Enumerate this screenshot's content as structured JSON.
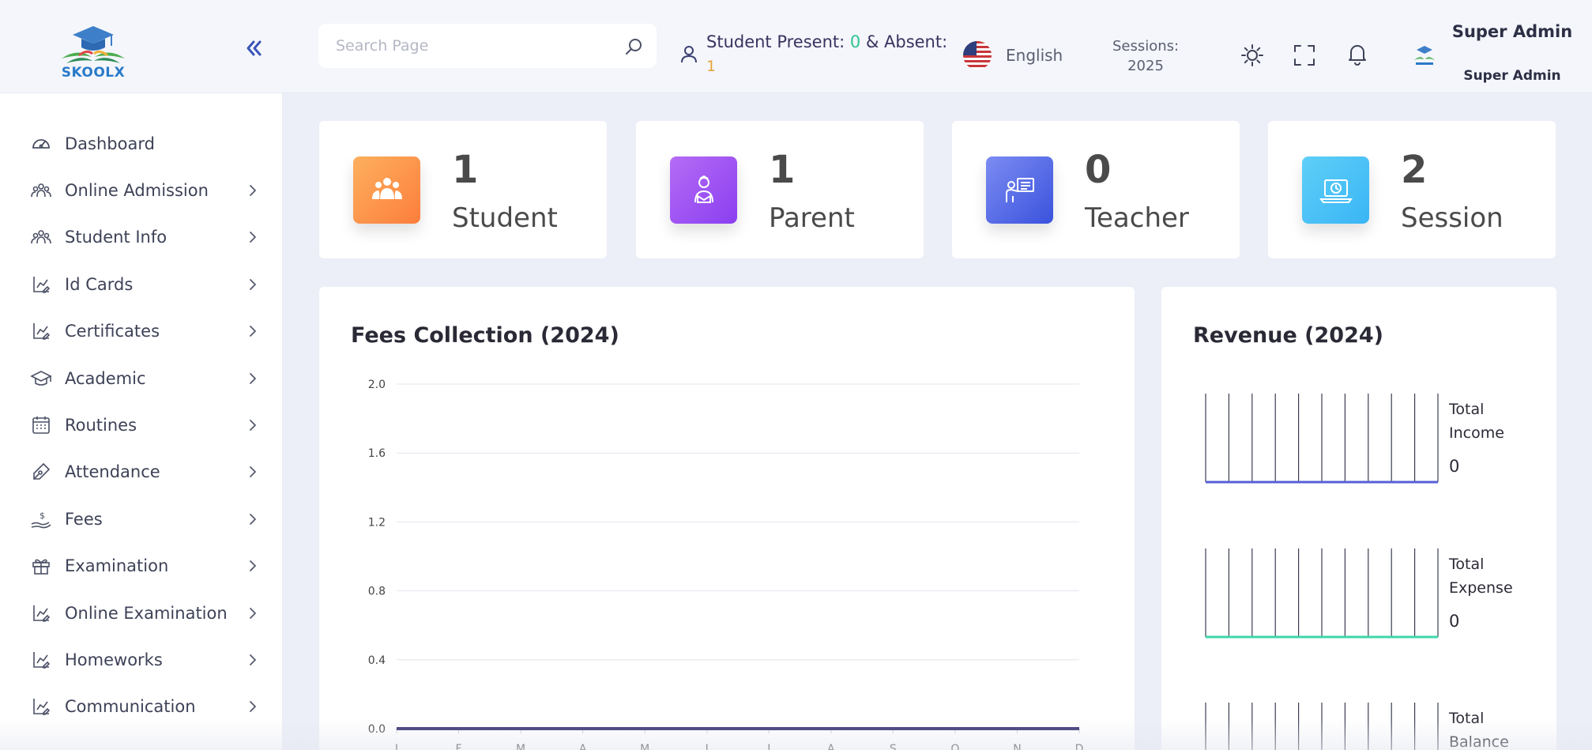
{
  "brand": {
    "name": "SKOOLX"
  },
  "sidebar": {
    "items": [
      {
        "label": "Dashboard",
        "icon": "dashboard-gauge-icon",
        "has_children": false
      },
      {
        "label": "Online Admission",
        "icon": "users-group-icon",
        "has_children": true
      },
      {
        "label": "Student Info",
        "icon": "users-group-icon",
        "has_children": true
      },
      {
        "label": "Id Cards",
        "icon": "chart-edit-icon",
        "has_children": true
      },
      {
        "label": "Certificates",
        "icon": "chart-edit-icon",
        "has_children": true
      },
      {
        "label": "Academic",
        "icon": "graduation-cap-icon",
        "has_children": true
      },
      {
        "label": "Routines",
        "icon": "calendar-icon",
        "has_children": true
      },
      {
        "label": "Attendance",
        "icon": "pen-icon",
        "has_children": true
      },
      {
        "label": "Fees",
        "icon": "money-hand-icon",
        "has_children": true
      },
      {
        "label": "Examination",
        "icon": "gift-box-icon",
        "has_children": true
      },
      {
        "label": "Online Examination",
        "icon": "chart-edit-icon",
        "has_children": true
      },
      {
        "label": "Homeworks",
        "icon": "chart-edit-icon",
        "has_children": true
      },
      {
        "label": "Communication",
        "icon": "chart-edit-icon",
        "has_children": true
      }
    ]
  },
  "header": {
    "search_placeholder": "Search Page",
    "presence": {
      "prefix": "Student Present: ",
      "present": "0",
      "middle": " & Absent:",
      "absent": "1"
    },
    "language": "English",
    "sessions_label": "Sessions:",
    "sessions_value": "2025",
    "user_name": "Super Admin",
    "user_role": "Super Admin"
  },
  "stats": [
    {
      "value": "1",
      "label": "Student",
      "color_from": "#fdb05e",
      "color_to": "#fd7e3c",
      "icon": "students-icon"
    },
    {
      "value": "1",
      "label": "Parent",
      "color_from": "#b56cf5",
      "color_to": "#8a3ff0",
      "icon": "parent-icon"
    },
    {
      "value": "0",
      "label": "Teacher",
      "color_from": "#7c8cf2",
      "color_to": "#3a52dd",
      "icon": "teacher-board-icon"
    },
    {
      "value": "2",
      "label": "Session",
      "color_from": "#5ecff7",
      "color_to": "#3ab5f5",
      "icon": "laptop-clock-icon"
    }
  ],
  "fees_panel": {
    "title": "Fees Collection (2024)"
  },
  "revenue_panel": {
    "title": "Revenue (2024)",
    "items": [
      {
        "label_line1": "Total",
        "label_line2": "Income",
        "value": "0",
        "color": "#5561d6"
      },
      {
        "label_line1": "Total",
        "label_line2": "Expense",
        "value": "0",
        "color": "#3fd6a8"
      },
      {
        "label_line1": "Total",
        "label_line2": "Balance",
        "value": "",
        "color": "#2a2a3a"
      }
    ]
  },
  "chart_data": {
    "type": "line",
    "title": "Fees Collection (2024)",
    "xlabel": "",
    "ylabel": "",
    "categories": [
      "J",
      "F",
      "M",
      "A",
      "M",
      "J",
      "J",
      "A",
      "S",
      "O",
      "N",
      "D"
    ],
    "series": [
      {
        "values": [
          0,
          0,
          0,
          0,
          0,
          0,
          0,
          0,
          0,
          0,
          0,
          0
        ]
      }
    ],
    "ylim": [
      0,
      2.0
    ],
    "yticks": [
      "0.0",
      "0.4",
      "0.8",
      "1.2",
      "1.6",
      "2.0"
    ],
    "grid": true,
    "line_color": "#2f2a6e"
  }
}
